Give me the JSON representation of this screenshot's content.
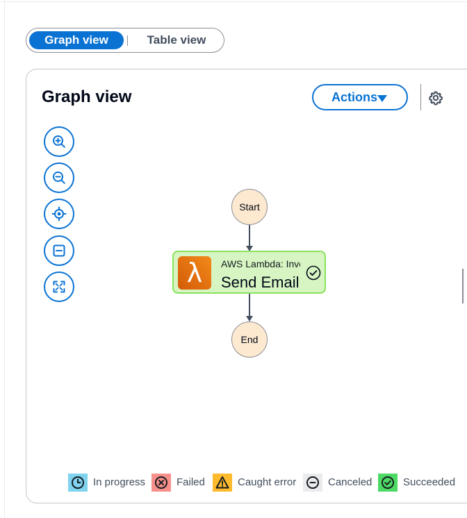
{
  "view_toggle": {
    "active_label": "Graph view",
    "inactive_label": "Table view"
  },
  "panel": {
    "title": "Graph view",
    "actions_label": "Actions"
  },
  "tools": [
    {
      "name": "zoom-in"
    },
    {
      "name": "zoom-out"
    },
    {
      "name": "center"
    },
    {
      "name": "collapse"
    },
    {
      "name": "fit-to-screen"
    }
  ],
  "graph": {
    "start_label": "Start",
    "end_label": "End",
    "task": {
      "type_label": "AWS Lambda: Invoke",
      "name": "Send Email",
      "status": "succeeded"
    }
  },
  "legend": [
    {
      "label": "In progress",
      "color": "#7fd3ef"
    },
    {
      "label": "Failed",
      "color": "#f7908a"
    },
    {
      "label": "Caught error",
      "color": "#fdba2d"
    },
    {
      "label": "Canceled",
      "color": "#e9ebed"
    },
    {
      "label": "Succeeded",
      "color": "#4cd964"
    }
  ],
  "colors": {
    "accent": "#0972d3",
    "state_fill": "#fde9cf",
    "task_fill": "#d7f5c2",
    "task_border": "#89e25c"
  }
}
